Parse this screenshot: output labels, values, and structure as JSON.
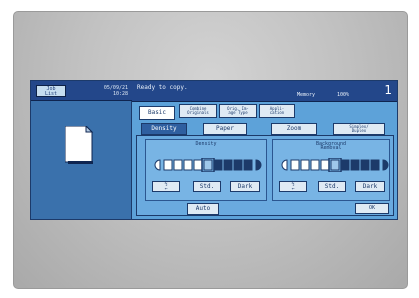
{
  "left_panel": {
    "job_list": [
      "Job",
      "List"
    ],
    "date": "05/09/21",
    "time": "10:28"
  },
  "header": {
    "status": "Ready to copy.",
    "memory_label": "Memory",
    "memory_value": "100%",
    "copy_count": "1"
  },
  "main_tabs": [
    {
      "label": [
        "Basic"
      ]
    },
    {
      "label": [
        "Combine",
        "Originals"
      ]
    },
    {
      "label": [
        "Orig. Im-",
        "age Type"
      ]
    },
    {
      "label": [
        "Appli-",
        "cation"
      ]
    }
  ],
  "sub_tabs": [
    {
      "label": [
        "Density"
      ]
    },
    {
      "label": [
        "Paper"
      ]
    },
    {
      "label": [
        "Zoom"
      ]
    },
    {
      "label": [
        "Simplex/",
        "Duplex"
      ]
    }
  ],
  "density": {
    "title": "Density",
    "light_symbol": [
      "½",
      "←"
    ],
    "std": "Std.",
    "dark": "Dark",
    "auto": "Auto",
    "level_index": 4
  },
  "background_removal": {
    "title": [
      "Background",
      "Removal"
    ],
    "light_symbol": [
      "½",
      "←"
    ],
    "std": "Std.",
    "dark": "Dark",
    "level_index": 4
  },
  "ok": "OK",
  "colors": {
    "screen": "#5da2d9",
    "header": "#23478a",
    "button": "#dfeaf4",
    "border": "#1c3a6a"
  }
}
